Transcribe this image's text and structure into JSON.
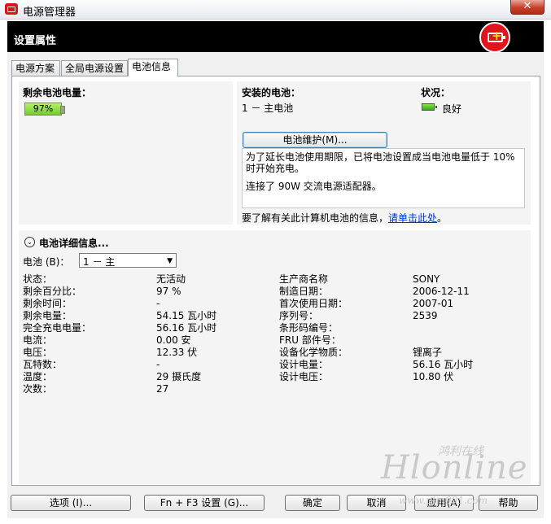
{
  "window": {
    "title": "电源管理器",
    "close": "✕"
  },
  "header": {
    "title": "设置属性"
  },
  "tabs": [
    "电源方案",
    "全局电源设置",
    "电池信息"
  ],
  "battery_level": {
    "label": "剩余电池电量：",
    "value": "97%",
    "percent": 97
  },
  "installed": {
    "label": "安装的电池：",
    "item": "1 － 主电池",
    "status_label": "状况：",
    "status_value": "良好",
    "maintenance_button": "电池维护(M)...",
    "info_text_1": "为了延长电池使用期限，已将电池设置成当电池电量低于 10% 时开始充电。",
    "info_text_2": "连接了 90W 交流电源适配器。",
    "more_text": "要了解有关此计算机电池的信息，",
    "more_link": "请单击此处",
    "more_end": "。"
  },
  "details": {
    "title": "电池详细信息...",
    "battery_select_label": "电池 (B)：",
    "battery_select_value": "1 － 主",
    "left": [
      {
        "label": "状态：",
        "value": "无活动"
      },
      {
        "label": "剩余百分比：",
        "value": "97 %"
      },
      {
        "label": "剩余时间：",
        "value": "-"
      },
      {
        "label": "剩余电量：",
        "value": "54.15 瓦小时"
      },
      {
        "label": "完全充电电量：",
        "value": "56.16 瓦小时"
      },
      {
        "label": "电流：",
        "value": "0.00 安"
      },
      {
        "label": "电压：",
        "value": "12.33 伏"
      },
      {
        "label": "瓦特数：",
        "value": "-"
      },
      {
        "label": "温度：",
        "value": "29 摄氏度"
      },
      {
        "label": "次数：",
        "value": "27"
      }
    ],
    "right": [
      {
        "label": "生产商名称",
        "value": "SONY"
      },
      {
        "label": "制造日期：",
        "value": "2006-12-11"
      },
      {
        "label": "首次使用日期：",
        "value": "2007-01"
      },
      {
        "label": "序列号：",
        "value": "2539"
      },
      {
        "label": "条形码编号：",
        "value": ""
      },
      {
        "label": "FRU 部件号：",
        "value": ""
      },
      {
        "label": "设备化学物质：",
        "value": "锂离子"
      },
      {
        "label": "设计电量：",
        "value": "56.16 瓦小时"
      },
      {
        "label": "设计电压：",
        "value": "10.80 伏"
      }
    ]
  },
  "buttons": {
    "options": "选项 (I)...",
    "fn_f3": "Fn + F3 设置 (G)...",
    "ok": "确定",
    "cancel": "取消",
    "apply": "应用(A)",
    "help": "帮助"
  },
  "watermark": {
    "line1": "鸿利在线",
    "line2": "Hlonline",
    "line3": "www.ptm991.com"
  },
  "colors": {
    "header_bg": "#000000",
    "logo_red": "#e0141b",
    "battery_green": "#6fcc2b",
    "link": "#0033cc"
  }
}
